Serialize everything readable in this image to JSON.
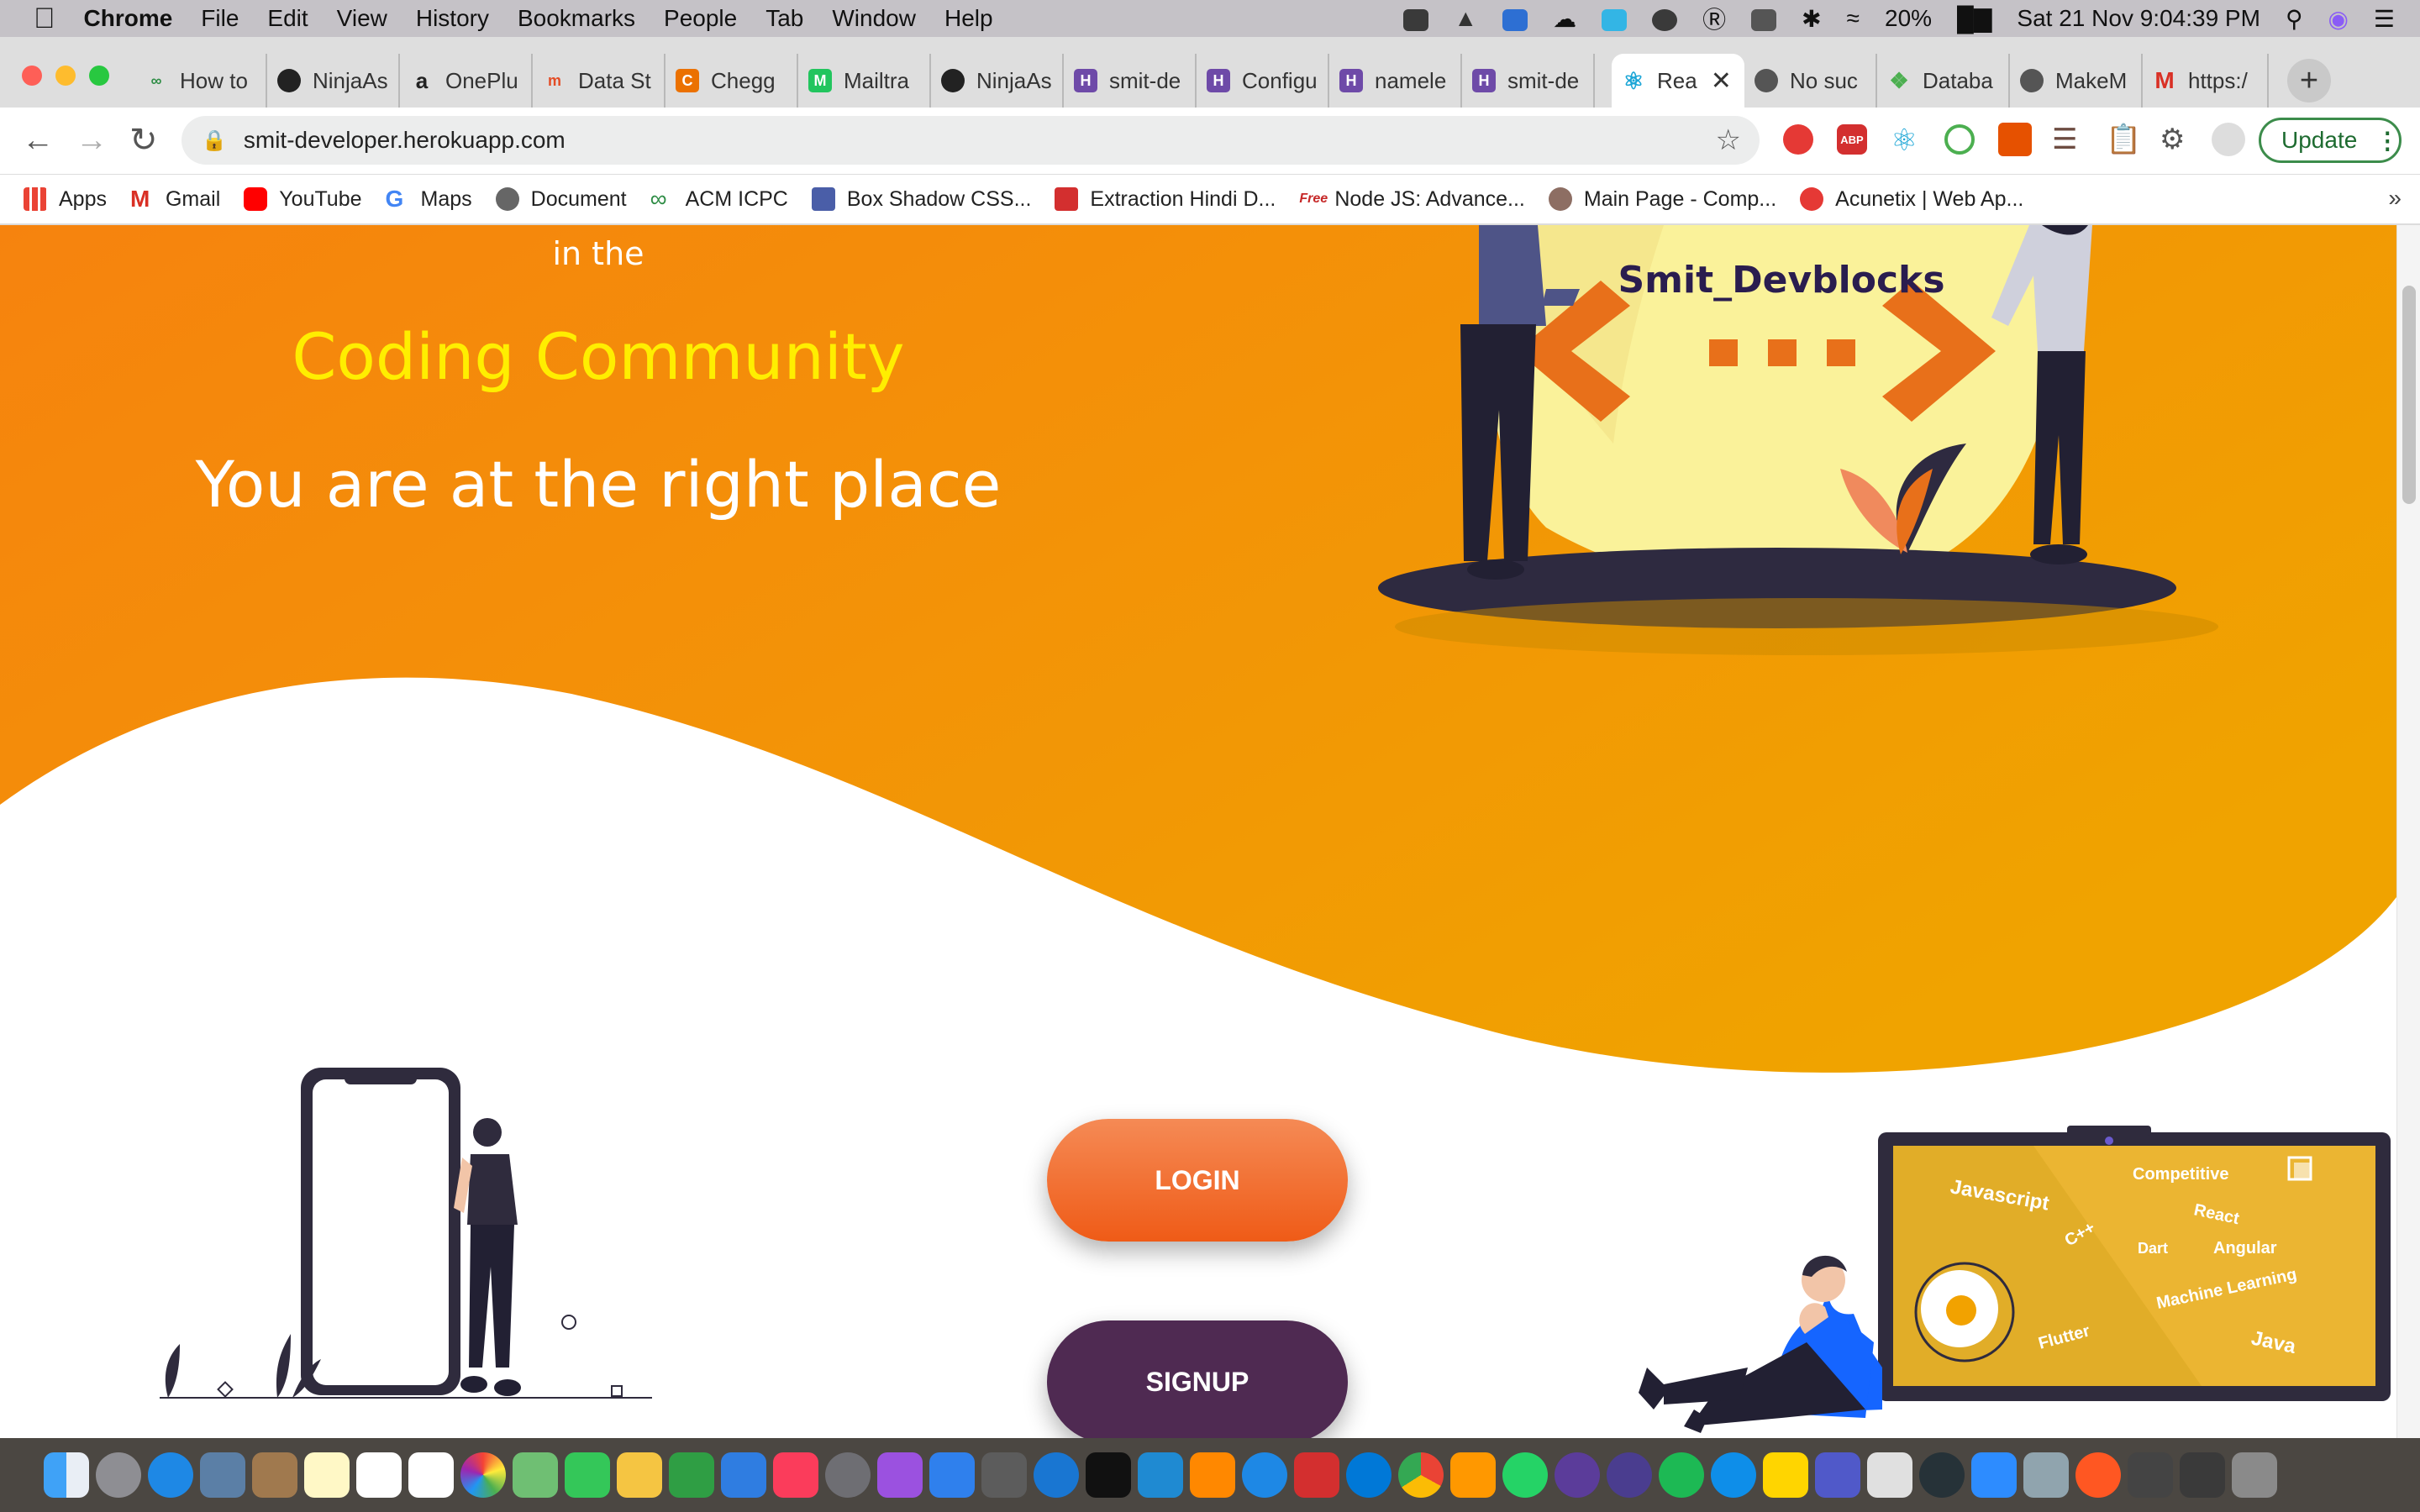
{
  "menubar": {
    "app_name": "Chrome",
    "items": [
      "File",
      "Edit",
      "View",
      "History",
      "Bookmarks",
      "People",
      "Tab",
      "Window",
      "Help"
    ],
    "battery": "20%",
    "datetime": "Sat 21 Nov  9:04:39 PM"
  },
  "tabs": [
    {
      "title": "How to",
      "icon": "gfg-icon",
      "color": "#2f8d46"
    },
    {
      "title": "NinjaAs",
      "icon": "github-icon",
      "color": "#222222"
    },
    {
      "title": "OnePlu",
      "icon": "amazon-icon",
      "color": "#ffffff"
    },
    {
      "title": "Data St",
      "icon": "hackerrank-icon",
      "color": "#e44d26"
    },
    {
      "title": "Chegg",
      "icon": "chegg-icon",
      "color": "#eb7100"
    },
    {
      "title": "Mailtra",
      "icon": "mailtrap-icon",
      "color": "#22c55e"
    },
    {
      "title": "NinjaAs",
      "icon": "github-icon",
      "color": "#222222"
    },
    {
      "title": "smit-de",
      "icon": "heroku-icon",
      "color": "#6e4aa8"
    },
    {
      "title": "Configu",
      "icon": "heroku-icon",
      "color": "#6e4aa8"
    },
    {
      "title": "namele",
      "icon": "heroku-icon",
      "color": "#6e4aa8"
    },
    {
      "title": "smit-de",
      "icon": "heroku-icon",
      "color": "#6e4aa8"
    },
    {
      "title": "Rea",
      "icon": "react-icon",
      "color": "#1aa5d6",
      "active": true
    },
    {
      "title": "No suc",
      "icon": "globe-icon",
      "color": "#555555"
    },
    {
      "title": "Databa",
      "icon": "mongodb-icon",
      "color": "#4caf50"
    },
    {
      "title": "MakeM",
      "icon": "globe-icon",
      "color": "#555555"
    },
    {
      "title": "https:/",
      "icon": "gmail-icon",
      "color": "#d93025"
    }
  ],
  "toolbar": {
    "url": "smit-developer.herokuapp.com",
    "update_label": "Update"
  },
  "bookmarks": [
    {
      "label": "Apps",
      "icon": "apps-grid-icon",
      "color": "#4285f4"
    },
    {
      "label": "Gmail",
      "icon": "gmail-icon",
      "color": "#d93025"
    },
    {
      "label": "YouTube",
      "icon": "youtube-icon",
      "color": "#ff0000"
    },
    {
      "label": "Maps",
      "icon": "google-icon",
      "color": "#4285f4"
    },
    {
      "label": "Document",
      "icon": "globe-icon",
      "color": "#666666"
    },
    {
      "label": "ACM ICPC",
      "icon": "gfg-icon",
      "color": "#2f8d46"
    },
    {
      "label": "Box Shadow CSS...",
      "icon": "box-icon",
      "color": "#4a5ea8"
    },
    {
      "label": "Extraction Hindi D...",
      "icon": "torrent-icon",
      "color": "#d32f2f"
    },
    {
      "label": "Node JS: Advance...",
      "icon": "freetutorials-icon",
      "color": "#c62828"
    },
    {
      "label": "Main Page - Comp...",
      "icon": "wiki-icon",
      "color": "#8d6e63"
    },
    {
      "label": "Acunetix | Web Ap...",
      "icon": "acunetix-icon",
      "color": "#e53935"
    }
  ],
  "hero": {
    "intro_line": "in the",
    "highlight": "Coding Community",
    "tagline": "You are at the right place",
    "brand": "Smit_Devblocks"
  },
  "actions": {
    "login_label": "LOGIN",
    "signup_label": "SIGNUP"
  },
  "laptop_words": [
    "Javascript",
    "Competitive",
    "React",
    "C++",
    "Dart",
    "Angular",
    "Machine Learning",
    "Flutter",
    "Java"
  ],
  "colors": {
    "orange_top": "#f6830e",
    "orange_bottom": "#f0a300",
    "highlight": "#ffee00",
    "login": "#f26b2f",
    "signup": "#4f2a52",
    "ink": "#2f2b3d"
  }
}
